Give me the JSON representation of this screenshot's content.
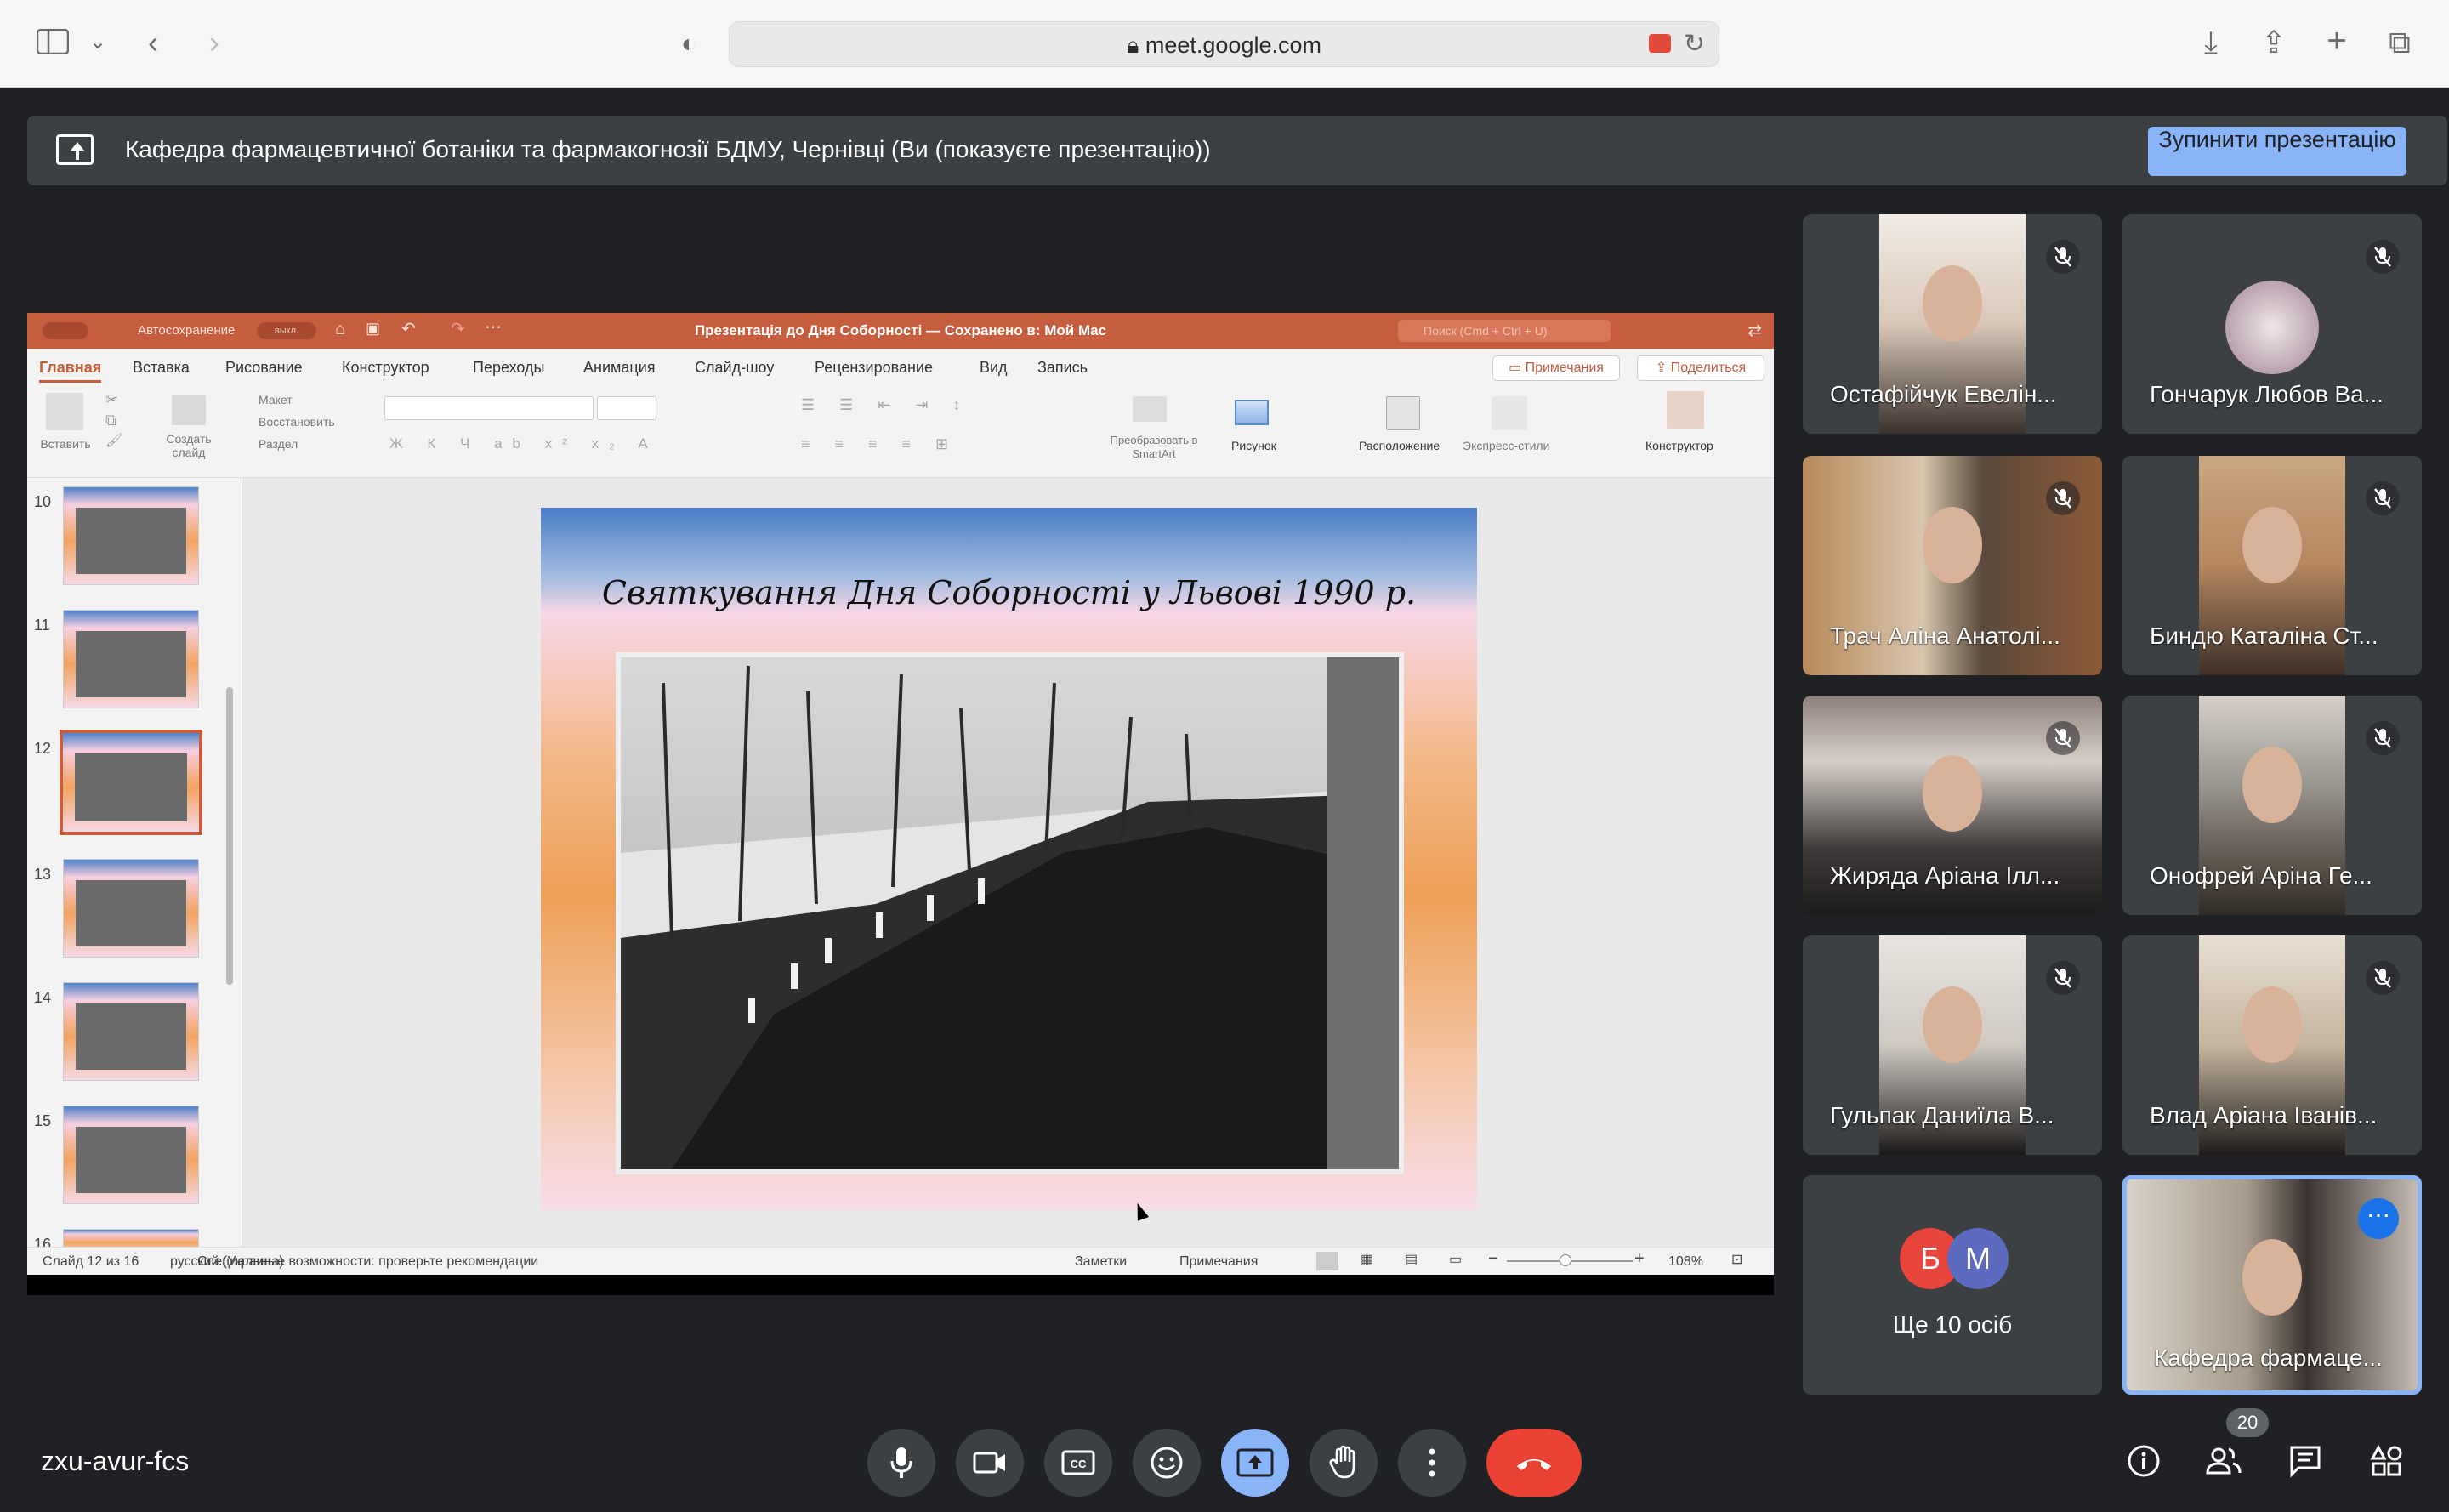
{
  "browser": {
    "url": "meet.google.com",
    "icons": [
      "sidebar-icon",
      "chevron-down-icon",
      "back-icon",
      "forward-icon",
      "shield-icon",
      "lock-icon",
      "camera-icon",
      "reload-icon",
      "download-icon",
      "share-icon",
      "plus-icon",
      "tabs-icon"
    ]
  },
  "banner": {
    "text": "Кафедра фармацевтичної ботаніки та фармакогнозії БДМУ, Чернівці (Ви (показуєте презентацію))",
    "stop_button": "Зупинити презентацію"
  },
  "ppt": {
    "autosave_label": "Автосохранение",
    "autosave_state": "выкл.",
    "doc_title": "Презентація до Дня Соборності — Сохранено в: Мой Mac",
    "search_placeholder": "Поиск (Cmd + Ctrl + U)",
    "tabs": [
      "Главная",
      "Вставка",
      "Рисование",
      "Конструктор",
      "Переходы",
      "Анимация",
      "Слайд-шоу",
      "Рецензирование",
      "Вид",
      "Запись"
    ],
    "active_tab": "Главная",
    "comments_button": "Примечания",
    "share_button": "Поделиться",
    "ribbon": {
      "paste": "Вставить",
      "new_slide": "Создать слайд",
      "layout": "Макет",
      "reset": "Восстановить",
      "section": "Раздел",
      "smartart": "Преобразовать в SmartArt",
      "picture": "Рисунок",
      "arrange": "Расположение",
      "quick_styles": "Экспресс-стили",
      "designer": "Конструктор"
    },
    "thumbnails": [
      {
        "num": "10",
        "selected": false
      },
      {
        "num": "11",
        "selected": false
      },
      {
        "num": "12",
        "selected": true
      },
      {
        "num": "13",
        "selected": false
      },
      {
        "num": "14",
        "selected": false
      },
      {
        "num": "15",
        "selected": false
      },
      {
        "num": "16",
        "selected": false
      }
    ],
    "slide_title": "Святкування Дня Соборності у Львові 1990 р.",
    "status": {
      "slide_of": "Слайд 12 из 16",
      "language": "русский (Украина)",
      "accessibility": "Специальные возможности: проверьте рекомендации",
      "notes": "Заметки",
      "comments": "Примечания",
      "zoom": "108%"
    }
  },
  "participants": [
    {
      "name": "Остафійчук Евелін...",
      "muted": true
    },
    {
      "name": "Гончарук Любов Ва...",
      "muted": true
    },
    {
      "name": "Трач Аліна Анатолі...",
      "muted": true
    },
    {
      "name": "Биндю Каталіна Ст...",
      "muted": true
    },
    {
      "name": "Жиряда Аріана Ілл...",
      "muted": true
    },
    {
      "name": "Онофрей Аріна Ге...",
      "muted": true
    },
    {
      "name": "Гульпак Даниїла В...",
      "muted": true
    },
    {
      "name": "Влад Аріана Іванів...",
      "muted": true
    }
  ],
  "others": {
    "initials": [
      "Б",
      "М"
    ],
    "label": "Ще 10 осіб",
    "colors": [
      "#e8453c",
      "#5c6bc0"
    ]
  },
  "self_tile": {
    "name": "Кафедра фармаце..."
  },
  "meeting_code": "zxu-avur-fcs",
  "controls": [
    "mic-icon",
    "camera-icon",
    "captions-icon",
    "emoji-icon",
    "present-icon",
    "raise-hand-icon",
    "more-icon",
    "end-call-icon"
  ],
  "right_controls": [
    "info-icon",
    "people-icon",
    "chat-icon",
    "activities-icon"
  ],
  "people_count": "20"
}
